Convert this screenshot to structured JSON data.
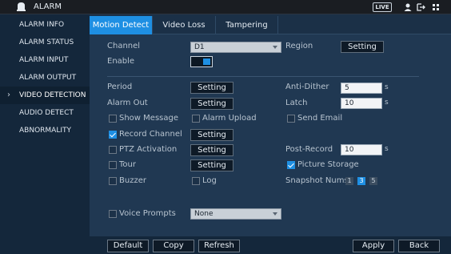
{
  "window": {
    "title": "ALARM",
    "live_label": "LIVE"
  },
  "sidebar": {
    "items": [
      {
        "label": "ALARM INFO"
      },
      {
        "label": "ALARM STATUS"
      },
      {
        "label": "ALARM INPUT"
      },
      {
        "label": "ALARM OUTPUT"
      },
      {
        "label": "VIDEO DETECTION",
        "active": true
      },
      {
        "label": "AUDIO DETECT"
      },
      {
        "label": "ABNORMALITY"
      }
    ]
  },
  "tabs": [
    {
      "label": "Motion Detect",
      "active": true
    },
    {
      "label": "Video Loss"
    },
    {
      "label": "Tampering"
    }
  ],
  "form": {
    "channel_label": "Channel",
    "channel_value": "D1",
    "region_label": "Region",
    "setting_label": "Setting",
    "enable_label": "Enable",
    "period_label": "Period",
    "anti_dither_label": "Anti-Dither",
    "anti_dither_value": "5",
    "seconds_unit": "s",
    "alarm_out_label": "Alarm Out",
    "latch_label": "Latch",
    "latch_value": "10",
    "show_message_label": "Show Message",
    "alarm_upload_label": "Alarm Upload",
    "send_email_label": "Send Email",
    "record_channel_label": "Record Channel",
    "ptz_activation_label": "PTZ Activation",
    "post_record_label": "Post-Record",
    "post_record_value": "10",
    "tour_label": "Tour",
    "picture_storage_label": "Picture Storage",
    "buzzer_label": "Buzzer",
    "log_label": "Log",
    "snapshot_nums_label": "Snapshot Nums",
    "snapshot_options": [
      "1",
      "3",
      "5"
    ],
    "voice_prompts_label": "Voice Prompts",
    "voice_prompts_value": "None"
  },
  "footer": {
    "default_label": "Default",
    "copy_label": "Copy",
    "refresh_label": "Refresh",
    "apply_label": "Apply",
    "back_label": "Back"
  },
  "colors": {
    "accent": "#1e8fe3",
    "background": "#203852",
    "sidebar": "#14273b"
  }
}
